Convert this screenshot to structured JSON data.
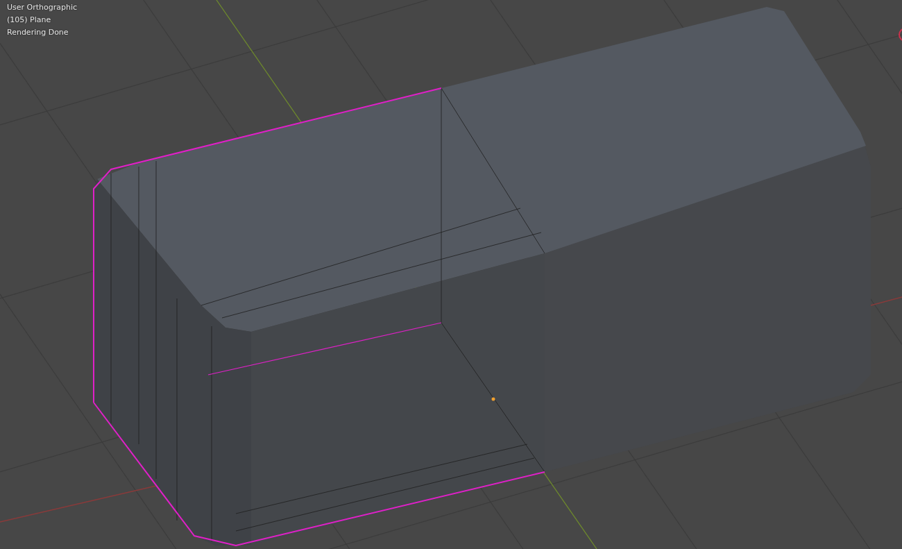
{
  "viewport": {
    "overlay_lines": [
      "User Orthographic",
      "(105) Plane",
      "Rendering Done"
    ]
  }
}
